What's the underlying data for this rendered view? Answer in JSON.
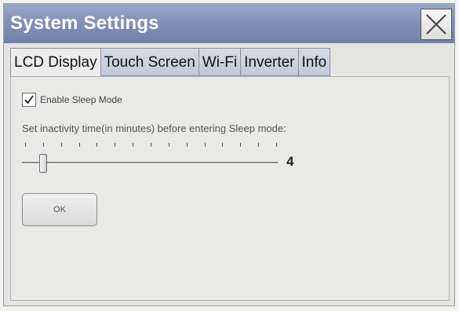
{
  "window": {
    "title": "System Settings"
  },
  "tabs": [
    {
      "label": "LCD Display",
      "active": true
    },
    {
      "label": "Touch Screen",
      "active": false
    },
    {
      "label": "Wi-Fi",
      "active": false
    },
    {
      "label": "Inverter",
      "active": false
    },
    {
      "label": "Info",
      "active": false
    }
  ],
  "lcd_display": {
    "sleep_mode": {
      "label": "Enable Sleep Mode",
      "checked": true
    },
    "inactivity_label": "Set inactivity time(in minutes) before entering Sleep mode:",
    "slider": {
      "value": "4",
      "fraction": 0.07
    },
    "ok_label": "OK"
  },
  "colors": {
    "titlebar": "#7d8db5",
    "tab_inactive": "#c9cfdf",
    "tab_active": "#ececec"
  },
  "icons": {
    "close": "close-icon",
    "check": "check-icon"
  }
}
